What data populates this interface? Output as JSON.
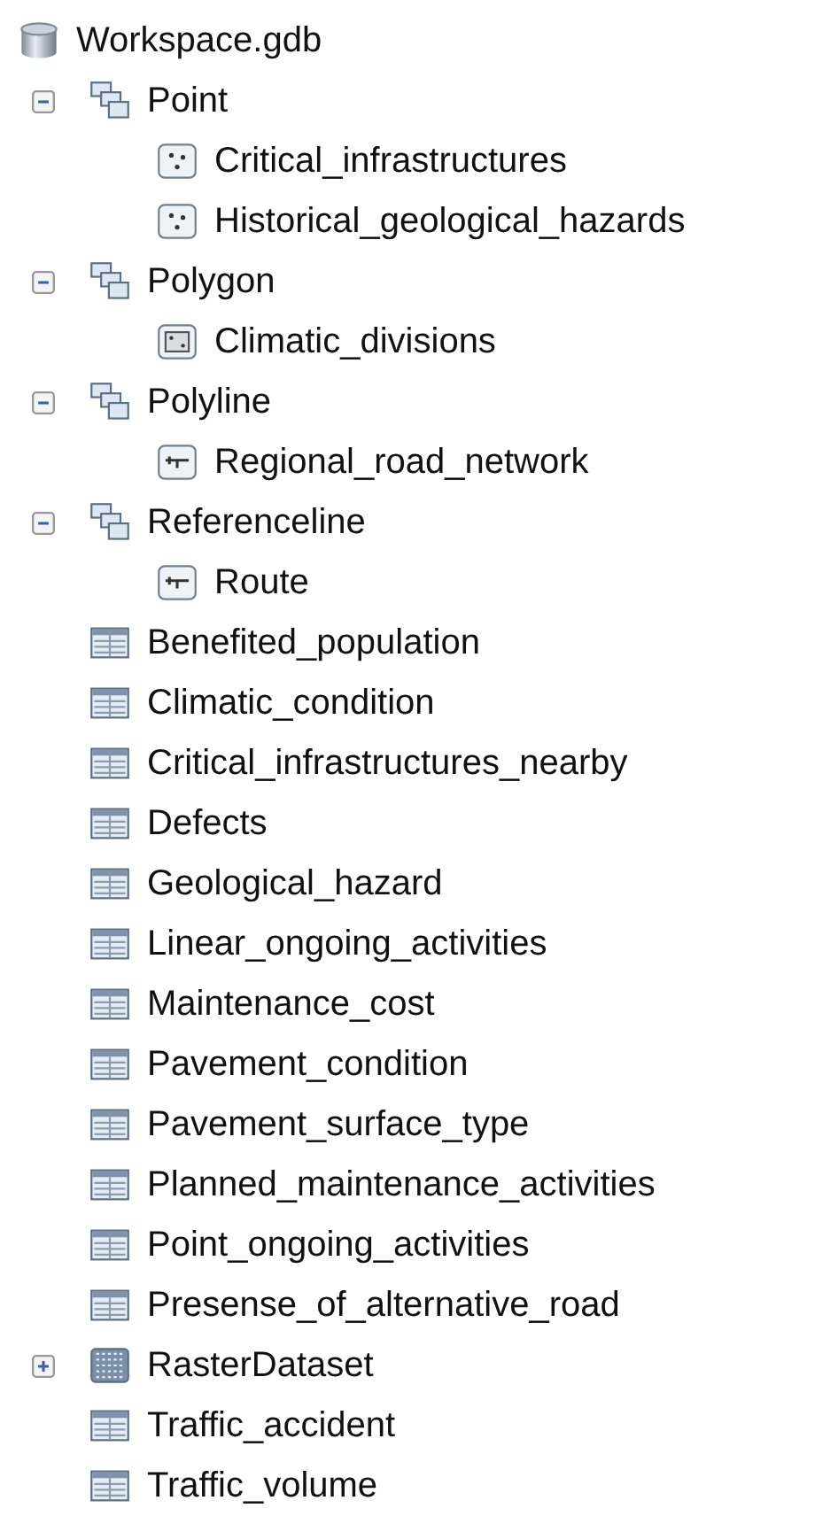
{
  "tree": {
    "label": "Workspace.gdb",
    "kind": "geodatabase",
    "children": [
      {
        "label": "Point",
        "kind": "dataset",
        "expanded": true,
        "children": [
          {
            "label": "Critical_infrastructures",
            "kind": "point"
          },
          {
            "label": "Historical_geological_hazards",
            "kind": "point"
          }
        ]
      },
      {
        "label": "Polygon",
        "kind": "dataset",
        "expanded": true,
        "children": [
          {
            "label": "Climatic_divisions",
            "kind": "polygon"
          }
        ]
      },
      {
        "label": "Polyline",
        "kind": "dataset",
        "expanded": true,
        "children": [
          {
            "label": "Regional_road_network",
            "kind": "line"
          }
        ]
      },
      {
        "label": "Referenceline",
        "kind": "dataset",
        "expanded": true,
        "children": [
          {
            "label": "Route",
            "kind": "line"
          }
        ]
      },
      {
        "label": "Benefited_population",
        "kind": "table"
      },
      {
        "label": "Climatic_condition",
        "kind": "table"
      },
      {
        "label": "Critical_infrastructures_nearby",
        "kind": "table"
      },
      {
        "label": "Defects",
        "kind": "table"
      },
      {
        "label": "Geological_hazard",
        "kind": "table"
      },
      {
        "label": "Linear_ongoing_activities",
        "kind": "table"
      },
      {
        "label": "Maintenance_cost",
        "kind": "table"
      },
      {
        "label": "Pavement_condition",
        "kind": "table"
      },
      {
        "label": "Pavement_surface_type",
        "kind": "table"
      },
      {
        "label": "Planned_maintenance_activities",
        "kind": "table"
      },
      {
        "label": "Point_ongoing_activities",
        "kind": "table"
      },
      {
        "label": "Presense_of_alternative_road",
        "kind": "table"
      },
      {
        "label": "RasterDataset",
        "kind": "raster",
        "expanded": false
      },
      {
        "label": "Traffic_accident",
        "kind": "table"
      },
      {
        "label": "Traffic_volume",
        "kind": "table"
      }
    ]
  }
}
